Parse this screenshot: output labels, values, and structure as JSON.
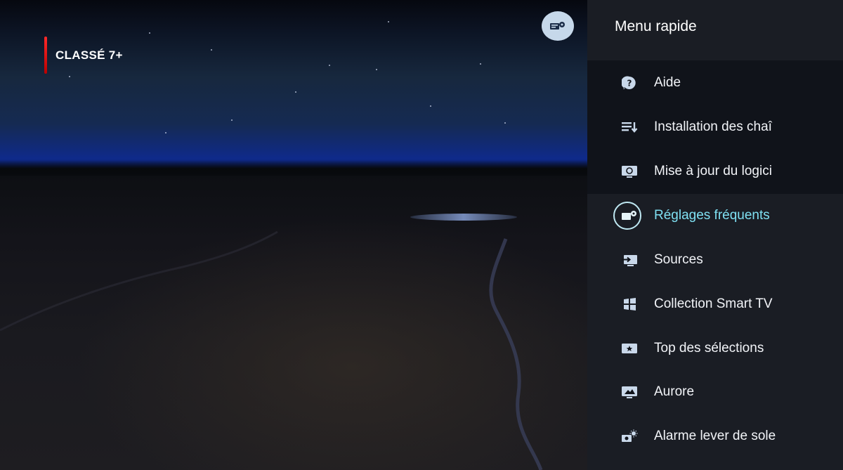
{
  "content_rating": "CLASSÉ 7+",
  "panel": {
    "title": "Menu rapide",
    "items": [
      {
        "label": "Aide",
        "icon": "help-icon"
      },
      {
        "label": "Installation des chaî",
        "icon": "channel-install-icon"
      },
      {
        "label": "Mise à jour du logici",
        "icon": "software-update-icon"
      },
      {
        "label": "Réglages fréquents",
        "icon": "frequent-settings-icon",
        "active": true
      },
      {
        "label": "Sources",
        "icon": "sources-icon"
      },
      {
        "label": "Collection Smart TV",
        "icon": "smart-tv-collection-icon"
      },
      {
        "label": "Top des sélections",
        "icon": "top-picks-icon"
      },
      {
        "label": "Aurore",
        "icon": "aurora-icon"
      },
      {
        "label": "Alarme lever de sole",
        "icon": "sunrise-alarm-icon"
      }
    ]
  },
  "colors": {
    "accent": "#7fe0f2",
    "rating_bar": "#ff2a2a",
    "panel_bg": "#1a1d24"
  }
}
